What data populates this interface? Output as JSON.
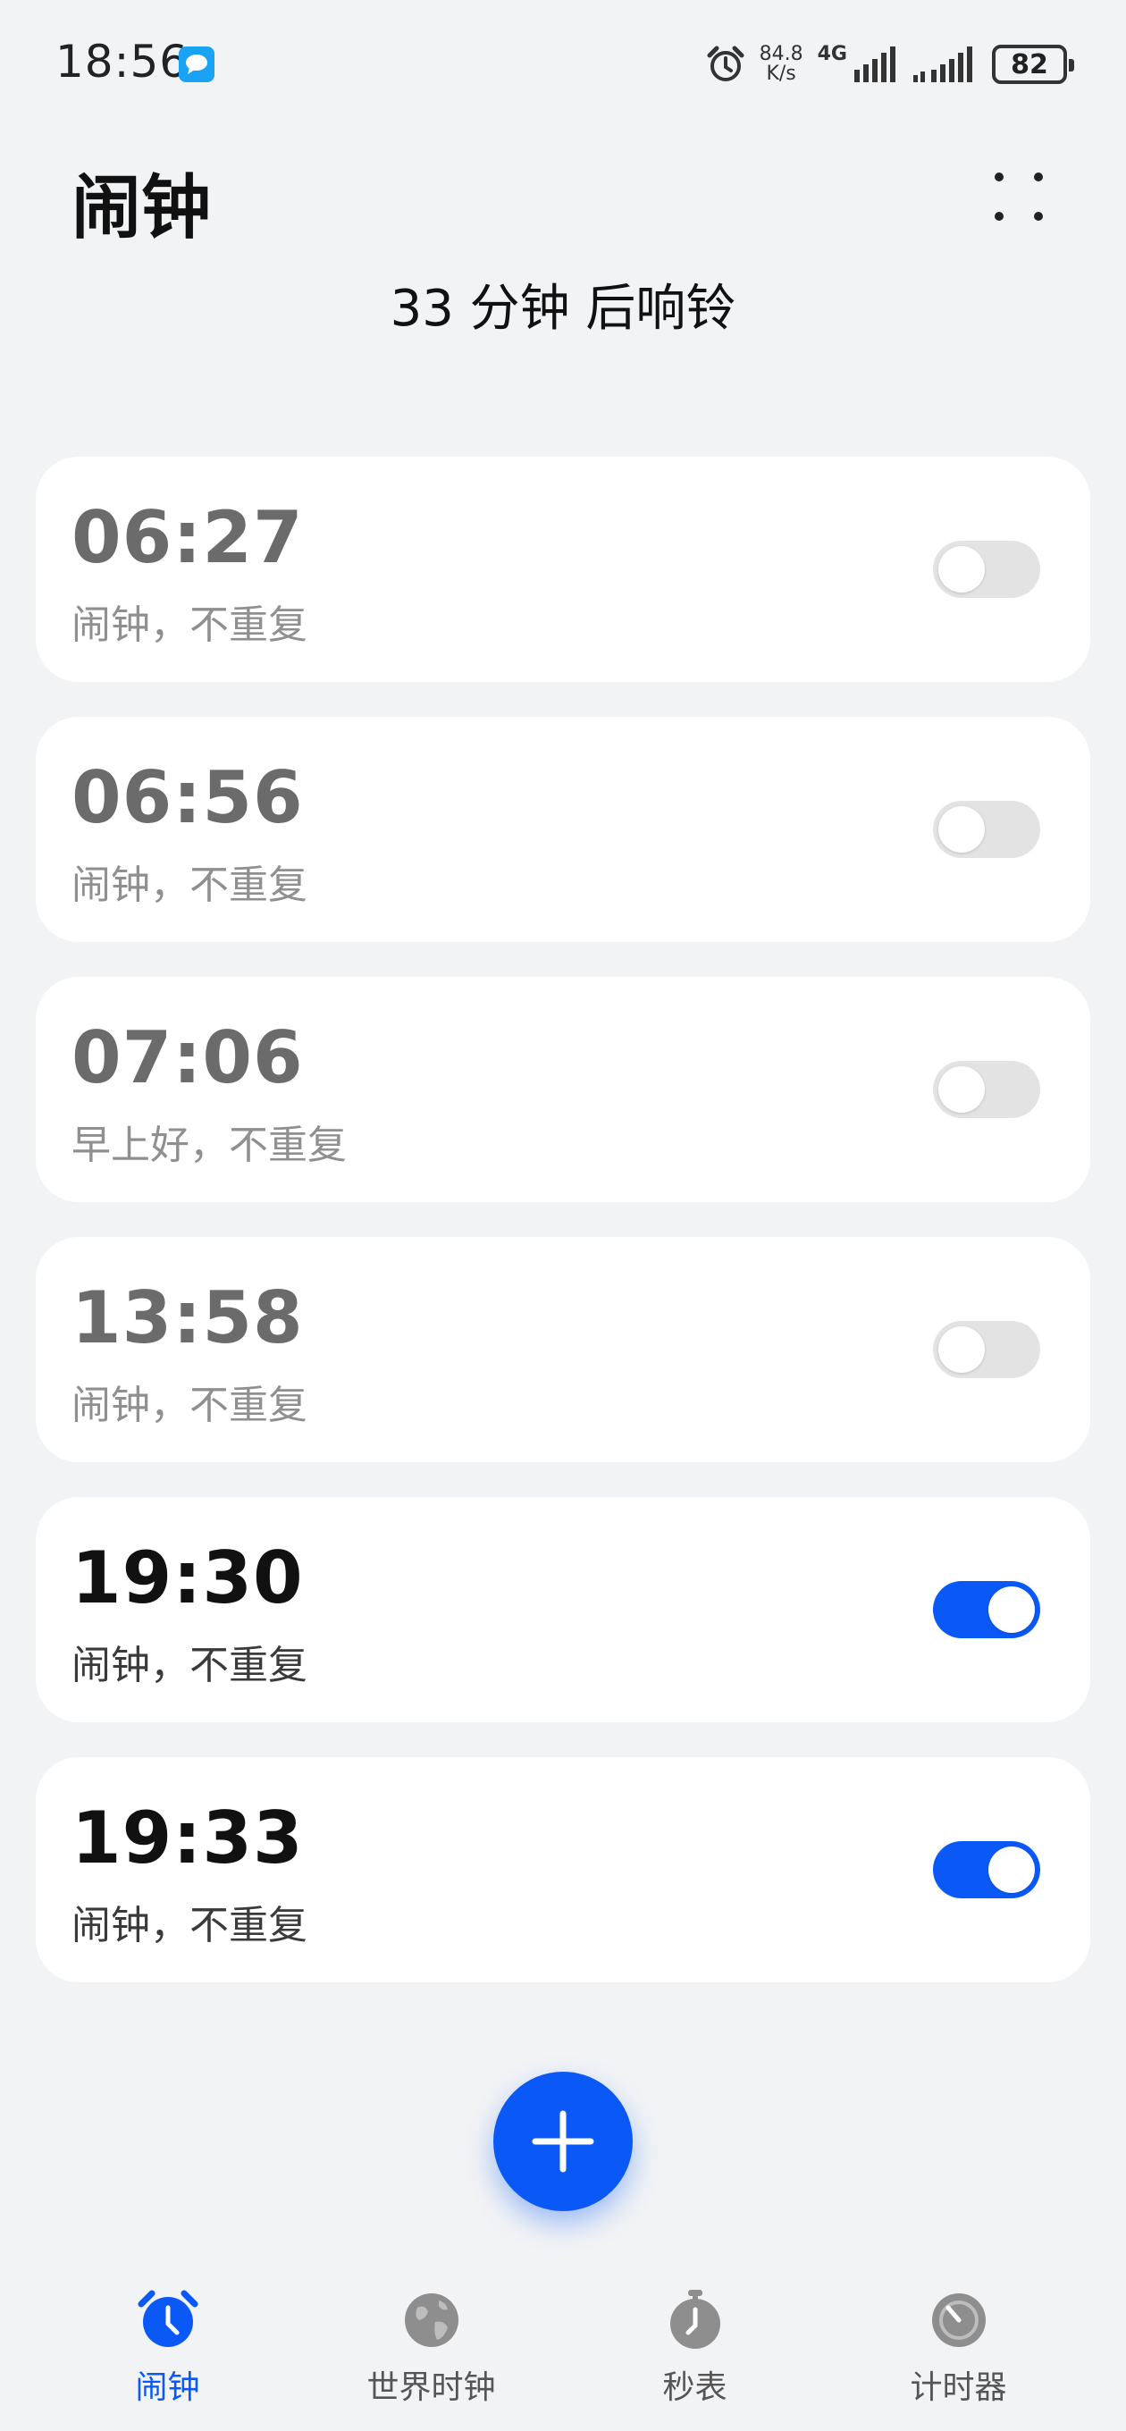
{
  "status_bar": {
    "time": "18:56",
    "net_speed_value": "84.8",
    "net_speed_unit": "K/s",
    "network_type": "4G",
    "battery": "82"
  },
  "header": {
    "title": "闹钟",
    "next_alarm": "33 分钟 后响铃"
  },
  "alarms": [
    {
      "time": "06:27",
      "label": "闹钟，不重复",
      "enabled": false
    },
    {
      "time": "06:56",
      "label": "闹钟，不重复",
      "enabled": false
    },
    {
      "time": "07:06",
      "label": "早上好，不重复",
      "enabled": false
    },
    {
      "time": "13:58",
      "label": "闹钟，不重复",
      "enabled": false
    },
    {
      "time": "19:30",
      "label": "闹钟，不重复",
      "enabled": true
    },
    {
      "time": "19:33",
      "label": "闹钟，不重复",
      "enabled": true
    }
  ],
  "bottom_nav": [
    {
      "label": "闹钟",
      "icon": "alarm-clock-icon",
      "active": true
    },
    {
      "label": "世界时钟",
      "icon": "globe-icon",
      "active": false
    },
    {
      "label": "秒表",
      "icon": "stopwatch-icon",
      "active": false
    },
    {
      "label": "计时器",
      "icon": "timer-icon",
      "active": false
    }
  ],
  "colors": {
    "accent": "#0a59f7",
    "background": "#f1f3f5",
    "card": "#ffffff",
    "toggle_off": "#e3e3e3"
  }
}
